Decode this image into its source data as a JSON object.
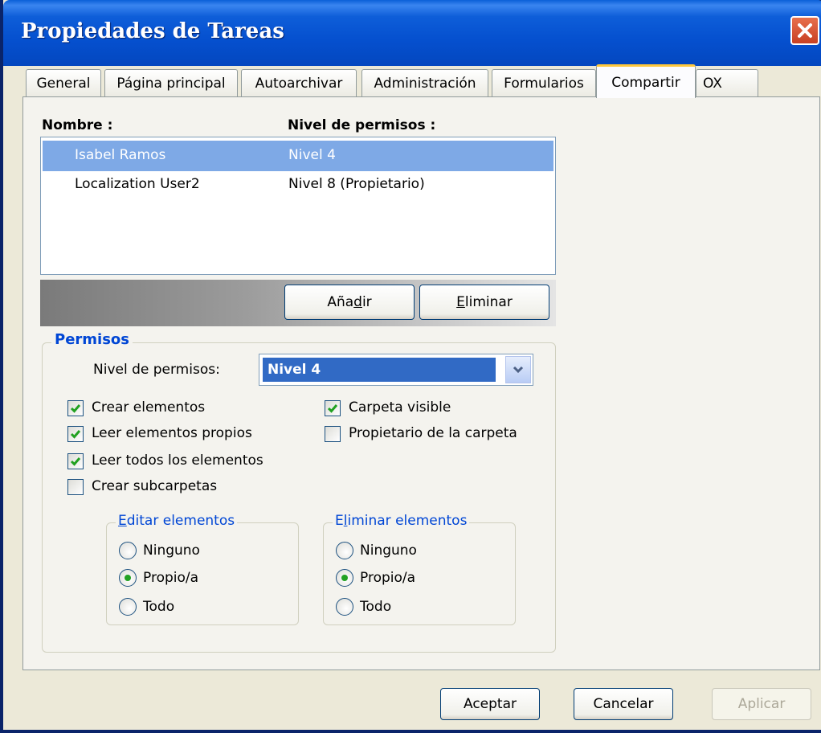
{
  "window": {
    "title": "Propiedades de Tareas",
    "close": "✕"
  },
  "tabs": [
    {
      "label": "General"
    },
    {
      "label": "Página principal"
    },
    {
      "label": "Autoarchivar"
    },
    {
      "label": "Administración"
    },
    {
      "label": "Formularios"
    },
    {
      "label": "Compartir",
      "active": true
    },
    {
      "label": "OX"
    }
  ],
  "list": {
    "header_name": "Nombre :",
    "header_level": "Nivel de permisos :",
    "rows": [
      {
        "name": "Isabel Ramos",
        "level": "Nivel 4",
        "selected": true
      },
      {
        "name": "Localization User2",
        "level": "Nivel 8 (Propietario)",
        "selected": false
      }
    ]
  },
  "buttons": {
    "add_pre": "Aña",
    "add_key": "d",
    "add_post": "ir",
    "remove_key": "E",
    "remove_post": "liminar"
  },
  "permissions": {
    "legend": "Permisos",
    "level_label": "Nivel de permisos:",
    "level_value": "Nivel 4",
    "checkboxes": [
      {
        "label": "Crear elementos",
        "checked": true
      },
      {
        "label": "Leer elementos propios",
        "checked": true
      },
      {
        "label": "Leer todos los elementos",
        "checked": true
      },
      {
        "label": "Crear subcarpetas",
        "checked": false
      },
      {
        "label": "Carpeta visible",
        "checked": true
      },
      {
        "label": "Propietario de la carpeta",
        "checked": false
      }
    ],
    "edit": {
      "legend_key": "E",
      "legend_post": "ditar elementos",
      "options": [
        "Ninguno",
        "Propio/a",
        "Todo"
      ],
      "selected": "Propio/a"
    },
    "delete": {
      "legend_pre": "E",
      "legend_key": "l",
      "legend_post": "iminar elementos",
      "options": [
        "Ninguno",
        "Propio/a",
        "Todo"
      ],
      "selected": "Propio/a"
    }
  },
  "footer": {
    "ok": "Aceptar",
    "cancel": "Cancelar",
    "apply": "Aplicar"
  },
  "colors": {
    "titlebar": "#0550CF",
    "selection": "#7EA9E6",
    "group_legend": "#0046D5",
    "check": "#21A121"
  }
}
